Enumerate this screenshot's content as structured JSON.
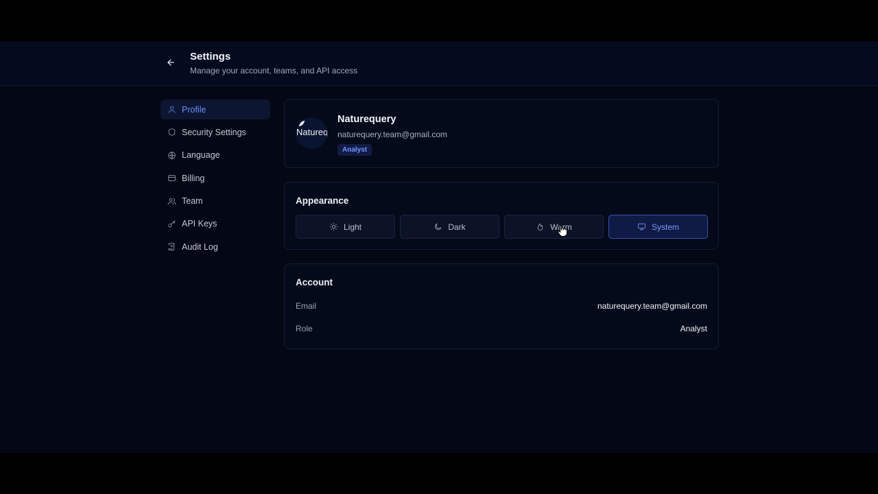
{
  "header": {
    "title": "Settings",
    "subtitle": "Manage your account, teams, and API access"
  },
  "sidebar": {
    "items": [
      {
        "label": "Profile",
        "icon": "user-icon",
        "active": true
      },
      {
        "label": "Security Settings",
        "icon": "shield-icon",
        "active": false
      },
      {
        "label": "Language",
        "icon": "globe-icon",
        "active": false
      },
      {
        "label": "Billing",
        "icon": "credit-card-icon",
        "active": false
      },
      {
        "label": "Team",
        "icon": "users-icon",
        "active": false
      },
      {
        "label": "API Keys",
        "icon": "key-icon",
        "active": false
      },
      {
        "label": "Audit Log",
        "icon": "scroll-icon",
        "active": false
      }
    ]
  },
  "profile": {
    "avatar_text": "Naturequery",
    "name": "Naturequery",
    "email": "naturequery.team@gmail.com",
    "role": "Analyst"
  },
  "appearance": {
    "title": "Appearance",
    "options": [
      {
        "label": "Light",
        "icon": "sun-icon"
      },
      {
        "label": "Dark",
        "icon": "moon-icon"
      },
      {
        "label": "Warm",
        "icon": "flame-icon"
      },
      {
        "label": "System",
        "icon": "monitor-icon"
      }
    ],
    "selected": "System"
  },
  "account": {
    "title": "Account",
    "rows": [
      {
        "label": "Email",
        "value": "naturequery.team@gmail.com"
      },
      {
        "label": "Role",
        "value": "Analyst"
      }
    ]
  },
  "colors": {
    "accent": "#6b8dff",
    "background": "#040814",
    "card": "#050a1a"
  }
}
